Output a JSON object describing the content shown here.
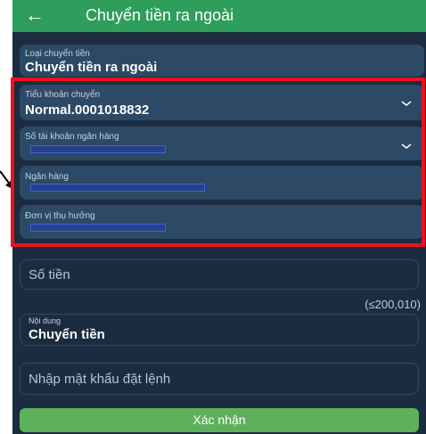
{
  "header": {
    "title": "Chuyển tiền ra ngoài",
    "back_icon": "arrow-left-icon"
  },
  "form": {
    "transfer_type": {
      "label": "Loại chuyển tiền",
      "value": "Chuyển tiền ra ngoài"
    },
    "sub_account": {
      "label": "Tiểu khoản chuyển",
      "value": "Normal.0001018832"
    },
    "bank_account_number": {
      "label": "Số tài khoản ngân hàng"
    },
    "bank": {
      "label": "Ngân hàng"
    },
    "beneficiary": {
      "label": "Đơn vị thụ hưởng"
    },
    "amount": {
      "placeholder": "Số tiền",
      "hint": "(≤200,010)"
    },
    "content": {
      "label": "Nội dung",
      "value": "Chuyển tiền"
    },
    "password": {
      "placeholder": "Nhập mật khẩu đặt lệnh"
    },
    "submit_label": "Xác nhận"
  },
  "colors": {
    "header": "#2f9e5c",
    "background": "#1b2c40",
    "field": "#2c4966",
    "highlight_frame": "#f0101a",
    "submit": "#5fb05a"
  }
}
